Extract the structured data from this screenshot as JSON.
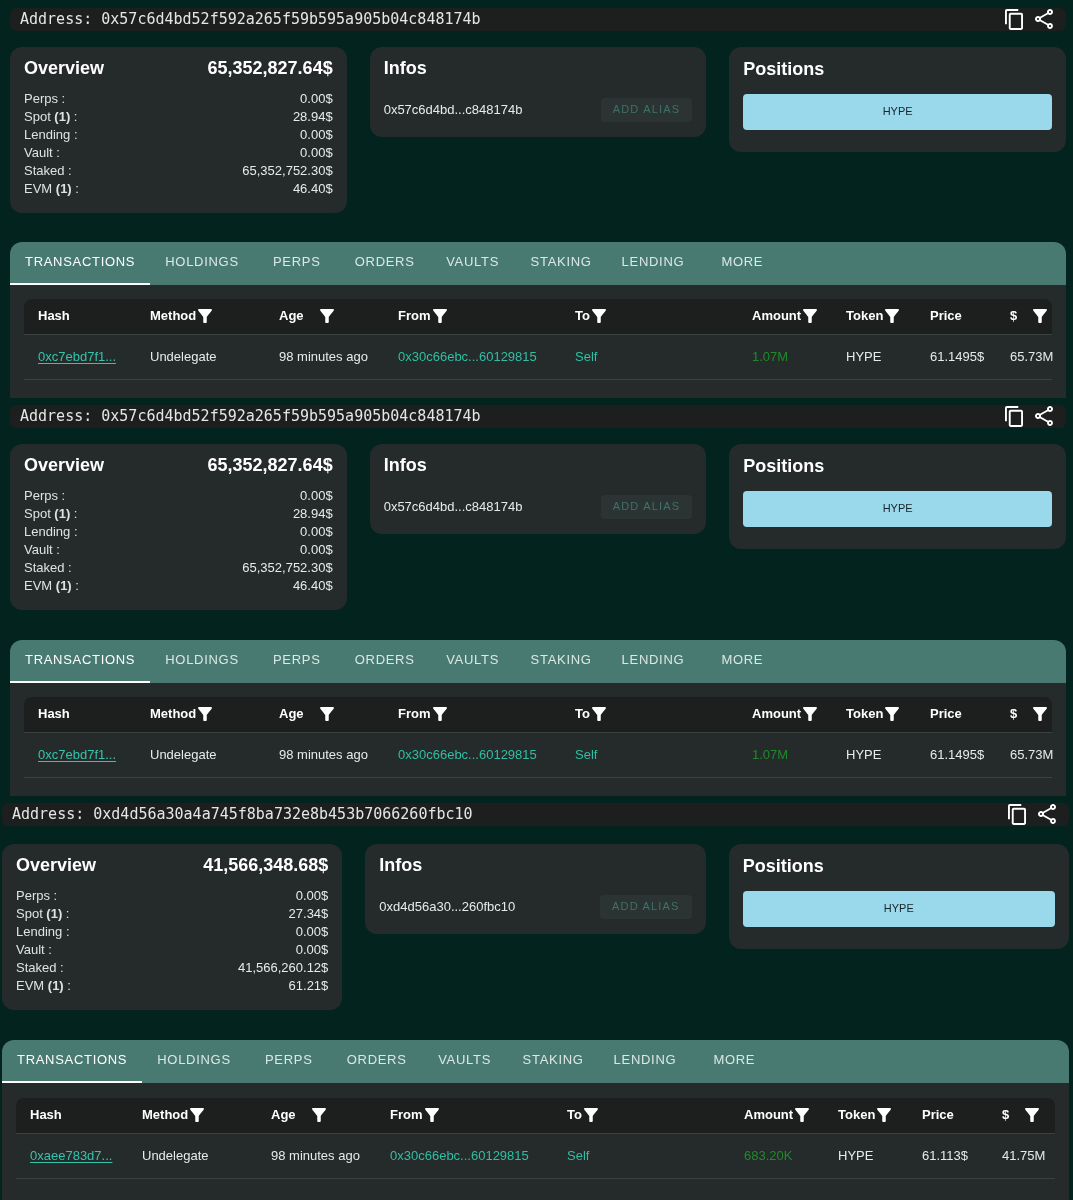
{
  "sections": [
    {
      "address_bar": {
        "text": "Address: 0x57c6d4bd52f592a265f59b595a905b04c848174b"
      },
      "overview": {
        "title": "Overview",
        "total": "65,352,827.64$",
        "rows": [
          {
            "label": "Perps :",
            "value": "0.00$"
          },
          {
            "label": "Spot **(1)** :",
            "value": "28.94$"
          },
          {
            "label": "Lending :",
            "value": "0.00$"
          },
          {
            "label": "Vault :",
            "value": "0.00$"
          },
          {
            "label": "Staked :",
            "value": "65,352,752.30$"
          },
          {
            "label": "EVM **(1)** :",
            "value": "46.40$"
          }
        ]
      },
      "infos": {
        "title": "Infos",
        "address": "0x57c6d4bd...c848174b",
        "button": {
          "label": "ADD ALIAS",
          "disabled": true
        }
      },
      "positions": {
        "title": "Positions",
        "items": [
          {
            "label": "HYPE"
          }
        ]
      },
      "tabs": [
        {
          "label": "TRANSACTIONS",
          "selected": true
        },
        {
          "label": "HOLDINGS",
          "selected": false
        },
        {
          "label": "PERPS",
          "selected": false
        },
        {
          "label": "ORDERS",
          "selected": false
        },
        {
          "label": "VAULTS",
          "selected": false
        },
        {
          "label": "STAKING",
          "selected": false
        },
        {
          "label": "LENDING",
          "selected": false
        },
        {
          "label": "MORE",
          "selected": false
        }
      ],
      "table": {
        "columns": [
          {
            "label": "Hash",
            "filter": false
          },
          {
            "label": "Method",
            "filter": true
          },
          {
            "label": "Age",
            "filter": true
          },
          {
            "label": "From",
            "filter": true
          },
          {
            "label": "To",
            "filter": true
          },
          {
            "label": "Amount",
            "filter": true
          },
          {
            "label": "Token",
            "filter": true
          },
          {
            "label": "Price",
            "filter": false
          },
          {
            "label": "$",
            "filter": true
          }
        ],
        "rows": [
          {
            "cells": [
              {
                "kind": "link",
                "text": "0xc7ebd7f1..."
              },
              {
                "kind": "text",
                "text": "Undelegate"
              },
              {
                "kind": "text",
                "text": "98 minutes ago"
              },
              {
                "kind": "address",
                "text": "0x30c66ebc...60129815"
              },
              {
                "kind": "address",
                "text": "Self"
              },
              {
                "kind": "amount",
                "text": "1.07M"
              },
              {
                "kind": "text",
                "text": "HYPE"
              },
              {
                "kind": "text",
                "text": "61.1495$"
              },
              {
                "kind": "text",
                "text": "65.73M"
              }
            ]
          }
        ]
      }
    },
    {
      "address_bar": {
        "text": "Address: 0x57c6d4bd52f592a265f59b595a905b04c848174b"
      },
      "overview": {
        "title": "Overview",
        "total": "65,352,827.64$",
        "rows": [
          {
            "label": "Perps :",
            "value": "0.00$"
          },
          {
            "label": "Spot **(1)** :",
            "value": "28.94$"
          },
          {
            "label": "Lending :",
            "value": "0.00$"
          },
          {
            "label": "Vault :",
            "value": "0.00$"
          },
          {
            "label": "Staked :",
            "value": "65,352,752.30$"
          },
          {
            "label": "EVM **(1)** :",
            "value": "46.40$"
          }
        ]
      },
      "infos": {
        "title": "Infos",
        "address": "0x57c6d4bd...c848174b",
        "button": {
          "label": "ADD ALIAS",
          "disabled": true
        }
      },
      "positions": {
        "title": "Positions",
        "items": [
          {
            "label": "HYPE"
          }
        ]
      },
      "tabs": [
        {
          "label": "TRANSACTIONS",
          "selected": true
        },
        {
          "label": "HOLDINGS",
          "selected": false
        },
        {
          "label": "PERPS",
          "selected": false
        },
        {
          "label": "ORDERS",
          "selected": false
        },
        {
          "label": "VAULTS",
          "selected": false
        },
        {
          "label": "STAKING",
          "selected": false
        },
        {
          "label": "LENDING",
          "selected": false
        },
        {
          "label": "MORE",
          "selected": false
        }
      ],
      "table": {
        "columns": [
          {
            "label": "Hash",
            "filter": false
          },
          {
            "label": "Method",
            "filter": true
          },
          {
            "label": "Age",
            "filter": true
          },
          {
            "label": "From",
            "filter": true
          },
          {
            "label": "To",
            "filter": true
          },
          {
            "label": "Amount",
            "filter": true
          },
          {
            "label": "Token",
            "filter": true
          },
          {
            "label": "Price",
            "filter": false
          },
          {
            "label": "$",
            "filter": true
          }
        ],
        "rows": [
          {
            "cells": [
              {
                "kind": "link",
                "text": "0xc7ebd7f1..."
              },
              {
                "kind": "text",
                "text": "Undelegate"
              },
              {
                "kind": "text",
                "text": "98 minutes ago"
              },
              {
                "kind": "address",
                "text": "0x30c66ebc...60129815"
              },
              {
                "kind": "address",
                "text": "Self"
              },
              {
                "kind": "amount",
                "text": "1.07M"
              },
              {
                "kind": "text",
                "text": "HYPE"
              },
              {
                "kind": "text",
                "text": "61.1495$"
              },
              {
                "kind": "text",
                "text": "65.73M"
              }
            ]
          }
        ]
      }
    },
    {
      "address_bar": {
        "text": "Address: 0xd4d56a30a4a745f8ba732e8b453b7066260fbc10"
      },
      "overview": {
        "title": "Overview",
        "total": "41,566,348.68$",
        "rows": [
          {
            "label": "Perps :",
            "value": "0.00$"
          },
          {
            "label": "Spot **(1)** :",
            "value": "27.34$"
          },
          {
            "label": "Lending :",
            "value": "0.00$"
          },
          {
            "label": "Vault :",
            "value": "0.00$"
          },
          {
            "label": "Staked :",
            "value": "41,566,260.12$"
          },
          {
            "label": "EVM **(1)** :",
            "value": "61.21$"
          }
        ]
      },
      "infos": {
        "title": "Infos",
        "address": "0xd4d56a30...260fbc10",
        "button": {
          "label": "ADD ALIAS",
          "disabled": true
        }
      },
      "positions": {
        "title": "Positions",
        "items": [
          {
            "label": "HYPE"
          }
        ]
      },
      "tabs": [
        {
          "label": "TRANSACTIONS",
          "selected": true
        },
        {
          "label": "HOLDINGS",
          "selected": false
        },
        {
          "label": "PERPS",
          "selected": false
        },
        {
          "label": "ORDERS",
          "selected": false
        },
        {
          "label": "VAULTS",
          "selected": false
        },
        {
          "label": "STAKING",
          "selected": false
        },
        {
          "label": "LENDING",
          "selected": false
        },
        {
          "label": "MORE",
          "selected": false
        }
      ],
      "table": {
        "columns": [
          {
            "label": "Hash",
            "filter": false
          },
          {
            "label": "Method",
            "filter": true
          },
          {
            "label": "Age",
            "filter": true
          },
          {
            "label": "From",
            "filter": true
          },
          {
            "label": "To",
            "filter": true
          },
          {
            "label": "Amount",
            "filter": true
          },
          {
            "label": "Token",
            "filter": true
          },
          {
            "label": "Price",
            "filter": false
          },
          {
            "label": "$",
            "filter": true
          }
        ],
        "rows": [
          {
            "cells": [
              {
                "kind": "link",
                "text": "0xaee783d7..."
              },
              {
                "kind": "text",
                "text": "Undelegate"
              },
              {
                "kind": "text",
                "text": "98 minutes ago"
              },
              {
                "kind": "address",
                "text": "0x30c66ebc...60129815"
              },
              {
                "kind": "address",
                "text": "Self"
              },
              {
                "kind": "amount",
                "text": "683.20K"
              },
              {
                "kind": "text",
                "text": "HYPE"
              },
              {
                "kind": "text",
                "text": "61.113$"
              },
              {
                "kind": "text",
                "text": "41.75M"
              }
            ]
          }
        ]
      }
    }
  ]
}
